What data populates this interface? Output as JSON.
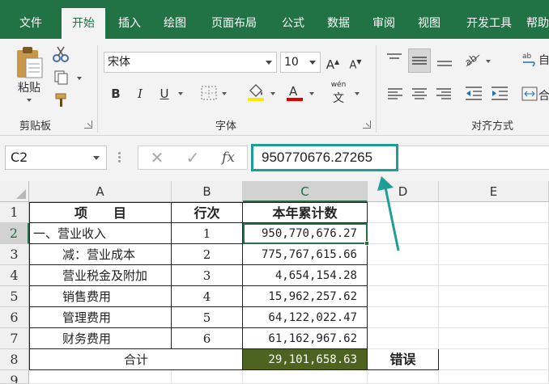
{
  "ribbon": {
    "tabs": [
      "文件",
      "开始",
      "插入",
      "绘图",
      "页面布局",
      "公式",
      "数据",
      "审阅",
      "视图",
      "开发工具",
      "帮助"
    ],
    "active_tab_index": 1,
    "clipboard": {
      "paste_label": "粘贴",
      "group_label": "剪贴板"
    },
    "font": {
      "font_name": "宋体",
      "font_size": "10",
      "bold": "B",
      "italic": "I",
      "underline": "U",
      "grow": "A",
      "shrink": "A",
      "phonetic_top": "wén",
      "phonetic_bottom": "文",
      "group_label": "字体"
    },
    "alignment": {
      "wrap_label": "自",
      "merge_label": "合",
      "group_label": "对齐方式"
    }
  },
  "formula_bar": {
    "name_box": "C2",
    "cancel_symbol": "✕",
    "enter_symbol": "✓",
    "fx_symbol": "fx",
    "value": "950770676.27265"
  },
  "sheet": {
    "columns": [
      "A",
      "B",
      "C",
      "D",
      "E"
    ],
    "selected_column": "C",
    "rows": [
      "1",
      "2",
      "3",
      "4",
      "5",
      "6",
      "7",
      "8",
      "9"
    ],
    "selected_row": "2",
    "header": {
      "item": "项　　目",
      "line_no": "行次",
      "ytd": "本年累计数"
    },
    "data": [
      {
        "item": "一、营业收入",
        "line_no": "1",
        "ytd": "950,770,676.27"
      },
      {
        "item": "减：营业成本",
        "line_no": "2",
        "ytd": "775,767,615.66"
      },
      {
        "item": "营业税金及附加",
        "line_no": "3",
        "ytd": "4,654,154.28"
      },
      {
        "item": "销售费用",
        "line_no": "4",
        "ytd": "15,962,257.62"
      },
      {
        "item": "管理费用",
        "line_no": "5",
        "ytd": "64,122,022.47"
      },
      {
        "item": "财务费用",
        "line_no": "6",
        "ytd": "61,162,967.62"
      }
    ],
    "total": {
      "label": "合计",
      "value": "29,101,658.63",
      "status": "错误"
    }
  },
  "colors": {
    "accent": "#217346",
    "highlight_border": "#1e9e95",
    "total_fill": "#4d6320",
    "font_color_bar": "#e00000",
    "fill_color_bar": "#ffe600"
  }
}
